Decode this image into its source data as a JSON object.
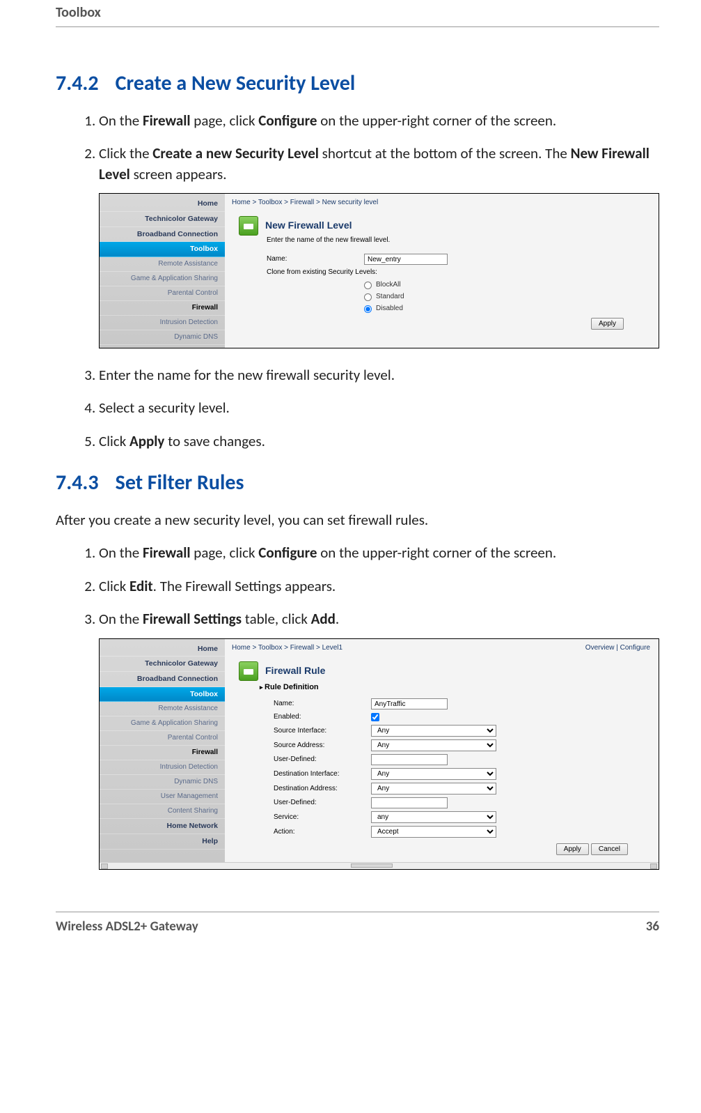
{
  "header": {
    "title": "Toolbox"
  },
  "section1": {
    "number": "7.4.2",
    "title": "Create a New Security Level",
    "steps": {
      "s1_a": "On the ",
      "s1_b": "Firewall",
      "s1_c": " page, click ",
      "s1_d": "Configure",
      "s1_e": " on the upper-right corner of the screen.",
      "s2_a": "Click the ",
      "s2_b": "Create a new Security Level",
      "s2_c": " shortcut at the bottom of the screen. The ",
      "s2_d": "New Firewall Level",
      "s2_e": " screen appears.",
      "s3": "Enter the name for the new firewall security level.",
      "s4": "Select a security level.",
      "s5_a": "Click ",
      "s5_b": "Apply",
      "s5_c": " to save changes."
    }
  },
  "shot1": {
    "breadcrumb": "Home > Toolbox > Firewall > New security level",
    "nav": [
      {
        "label": "Home",
        "cls": "bold"
      },
      {
        "label": "Technicolor Gateway",
        "cls": "bold"
      },
      {
        "label": "Broadband Connection",
        "cls": "bold"
      },
      {
        "label": "Toolbox",
        "cls": "sel"
      },
      {
        "label": "Remote Assistance",
        "cls": "sub"
      },
      {
        "label": "Game & Application Sharing",
        "cls": "sub"
      },
      {
        "label": "Parental Control",
        "cls": "sub"
      },
      {
        "label": "Firewall",
        "cls": "sub bold"
      },
      {
        "label": "Intrusion Detection",
        "cls": "sub"
      },
      {
        "label": "Dynamic DNS",
        "cls": "sub"
      }
    ],
    "panel_title": "New Firewall Level",
    "panel_sub": "Enter the name of the new firewall level.",
    "name_label": "Name:",
    "name_value": "New_entry",
    "clone_label": "Clone from existing Security Levels:",
    "radios": [
      "BlockAll",
      "Standard",
      "Disabled"
    ],
    "radio_selected": 2,
    "apply": "Apply"
  },
  "section2": {
    "number": "7.4.3",
    "title": "Set Filter Rules",
    "intro": "After you create a new security level, you can set firewall rules.",
    "steps": {
      "s1_a": "On the ",
      "s1_b": "Firewall",
      "s1_c": " page, click ",
      "s1_d": "Configure",
      "s1_e": " on the upper-right corner of the screen.",
      "s2_a": "Click ",
      "s2_b": "Edit",
      "s2_c": ". The Firewall Settings appears.",
      "s3_a": "On the ",
      "s3_b": "Firewall Settings",
      "s3_c": " table, click ",
      "s3_d": "Add",
      "s3_e": "."
    }
  },
  "shot2": {
    "breadcrumb": "Home > Toolbox > Firewall > Level1",
    "toplinks": "Overview | Configure",
    "nav": [
      {
        "label": "Home",
        "cls": "bold"
      },
      {
        "label": "Technicolor Gateway",
        "cls": "bold"
      },
      {
        "label": "Broadband Connection",
        "cls": "bold"
      },
      {
        "label": "Toolbox",
        "cls": "sel"
      },
      {
        "label": "Remote Assistance",
        "cls": "sub"
      },
      {
        "label": "Game & Application Sharing",
        "cls": "sub"
      },
      {
        "label": "Parental Control",
        "cls": "sub"
      },
      {
        "label": "Firewall",
        "cls": "sub bold"
      },
      {
        "label": "Intrusion Detection",
        "cls": "sub"
      },
      {
        "label": "Dynamic DNS",
        "cls": "sub"
      },
      {
        "label": "User Management",
        "cls": "sub"
      },
      {
        "label": "Content Sharing",
        "cls": "sub"
      },
      {
        "label": "Home Network",
        "cls": "bold"
      },
      {
        "label": "Help",
        "cls": "bold"
      }
    ],
    "panel_title": "Firewall Rule",
    "subhead": "Rule Definition",
    "fields": {
      "name": {
        "label": "Name:",
        "value": "AnyTraffic"
      },
      "enabled": {
        "label": "Enabled:",
        "checked": true
      },
      "src_if": {
        "label": "Source Interface:",
        "value": "Any"
      },
      "src_addr": {
        "label": "Source Address:",
        "value": "Any"
      },
      "user_def1": {
        "label": "User-Defined:",
        "value": ""
      },
      "dst_if": {
        "label": "Destination Interface:",
        "value": "Any"
      },
      "dst_addr": {
        "label": "Destination Address:",
        "value": "Any"
      },
      "user_def2": {
        "label": "User-Defined:",
        "value": ""
      },
      "service": {
        "label": "Service:",
        "value": "any"
      },
      "action": {
        "label": "Action:",
        "value": "Accept"
      }
    },
    "apply": "Apply",
    "cancel": "Cancel"
  },
  "footer": {
    "product": "Wireless ADSL2+ Gateway",
    "page": "36"
  }
}
